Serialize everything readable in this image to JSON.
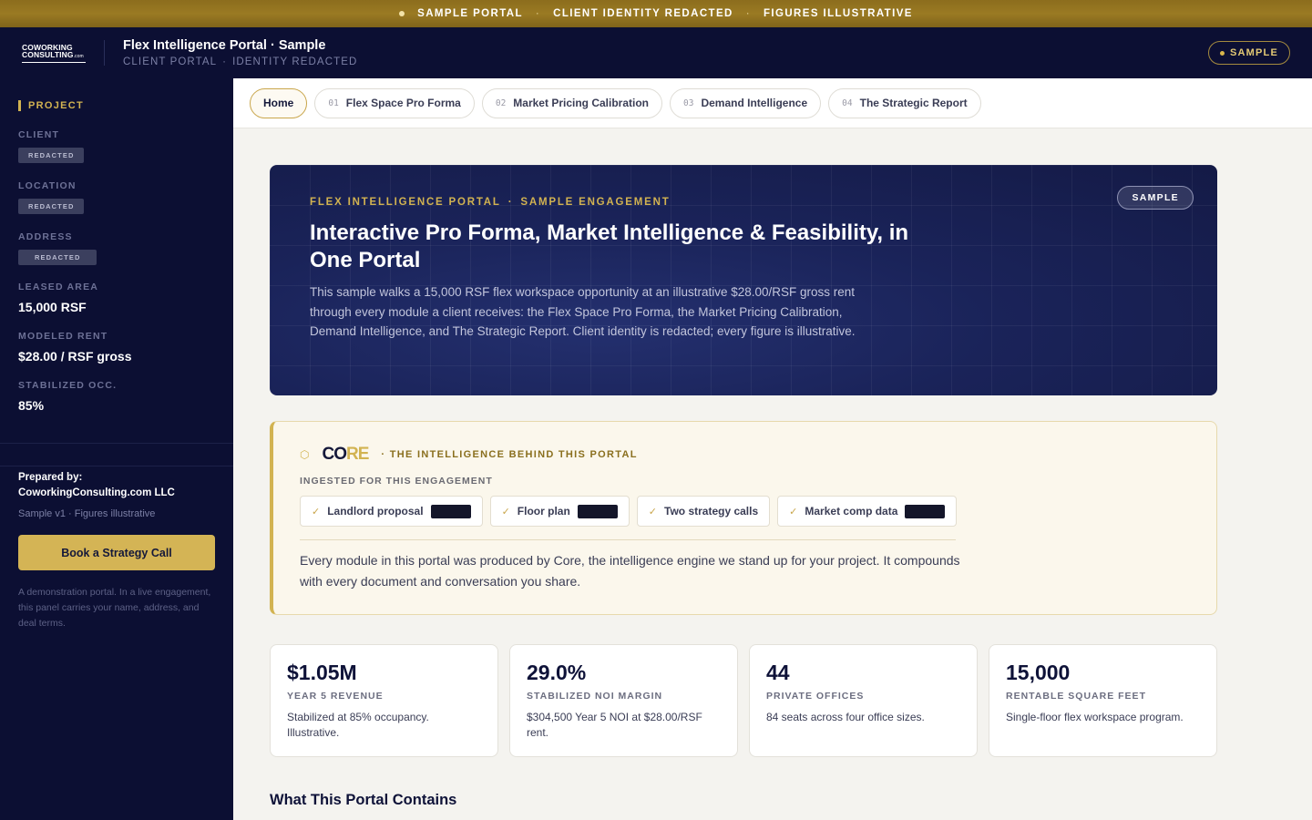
{
  "banner": {
    "items": [
      "SAMPLE PORTAL",
      "CLIENT IDENTITY REDACTED",
      "FIGURES ILLUSTRATIVE"
    ],
    "separator": "·"
  },
  "header": {
    "logo_line1": "COWORKING",
    "logo_line2": "CONSULTING",
    "logo_line2_suffix": ".com",
    "title": "Flex Intelligence Portal · Sample",
    "subtitle_left": "CLIENT PORTAL",
    "subtitle_sep": "·",
    "subtitle_right": "IDENTITY REDACTED",
    "badge": "SAMPLE"
  },
  "sidebar": {
    "section": "PROJECT",
    "client_label": "CLIENT",
    "client_value": "REDACTED",
    "location_label": "LOCATION",
    "location_value": "REDACTED",
    "address_label": "ADDRESS",
    "address_value": "REDACTED",
    "area_label": "LEASED AREA",
    "area_value": "15,000 RSF",
    "rent_label": "MODELED RENT",
    "rent_value": "$28.00 / RSF gross",
    "occ_label": "STABILIZED OCC.",
    "occ_value": "85%",
    "prepared_by_label": "Prepared by:",
    "prepared_by_value": "CoworkingConsulting.com LLC",
    "version": "Sample v1 · Figures illustrative",
    "cta": "Book a Strategy Call",
    "note": "A demonstration portal. In a live engagement, this panel carries your name, address, and deal terms."
  },
  "tabs": [
    {
      "num": "",
      "label": "Home",
      "active": true
    },
    {
      "num": "01",
      "label": "Flex Space Pro Forma",
      "active": false
    },
    {
      "num": "02",
      "label": "Market Pricing Calibration",
      "active": false
    },
    {
      "num": "03",
      "label": "Demand Intelligence",
      "active": false
    },
    {
      "num": "04",
      "label": "The Strategic Report",
      "active": false
    }
  ],
  "hero": {
    "eyebrow_left": "FLEX INTELLIGENCE PORTAL",
    "eyebrow_sep": "·",
    "eyebrow_right": "SAMPLE ENGAGEMENT",
    "title": "Interactive Pro Forma, Market Intelligence & Feasibility, in One Portal",
    "description": "This sample walks a 15,000 RSF flex workspace opportunity at an illustrative $28.00/RSF gross rent through every module a client receives: the Flex Space Pro Forma, the Market Pricing Calibration, Demand Intelligence, and The Strategic Report. Client identity is redacted; every figure is illustrative.",
    "badge": "SAMPLE"
  },
  "core": {
    "logo_a": "CO",
    "logo_b": "RE",
    "tagline": "· THE INTELLIGENCE BEHIND THIS PORTAL",
    "ingested_label": "INGESTED FOR THIS ENGAGEMENT",
    "chips": [
      {
        "label": "Landlord proposal",
        "redacted": true
      },
      {
        "label": "Floor plan",
        "redacted": true
      },
      {
        "label": "Two strategy calls",
        "redacted": false
      },
      {
        "label": "Market comp data",
        "redacted": true
      }
    ],
    "description": "Every module in this portal was produced by Core, the intelligence engine we stand up for your project. It compounds with every document and conversation you share."
  },
  "stats": [
    {
      "value": "$1.05M",
      "label": "YEAR 5 REVENUE",
      "desc": "Stabilized at 85% occupancy. Illustrative."
    },
    {
      "value": "29.0%",
      "label": "STABILIZED NOI MARGIN",
      "desc": "$304,500 Year 5 NOI at $28.00/RSF rent."
    },
    {
      "value": "44",
      "label": "PRIVATE OFFICES",
      "desc": "84 seats across four office sizes."
    },
    {
      "value": "15,000",
      "label": "RENTABLE SQUARE FEET",
      "desc": "Single-floor flex workspace program."
    }
  ],
  "section_title": "What This Portal Contains",
  "colors": {
    "navy": "#0c0f33",
    "gold": "#d2b351",
    "cream": "#fbf7ec",
    "background": "#f4f3ef"
  }
}
